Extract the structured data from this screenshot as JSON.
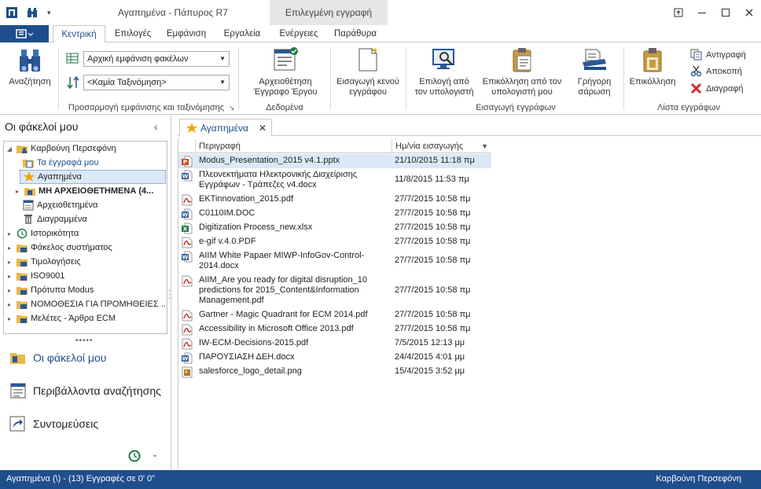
{
  "window": {
    "title": "Αγαπημένα - Πάπυρος R7",
    "context_tab": "Επιλεγμένη εγγραφή"
  },
  "ribbon": {
    "tabs": [
      "Κεντρική",
      "Επιλογές",
      "Εμφάνιση",
      "Εργαλεία",
      "Ενέργειες",
      "Παράθυρα"
    ],
    "active_tab": "Κεντρική",
    "search_label": "Αναζήτηση",
    "view_combo": "Αρχική εμφάνιση φακέλων",
    "sort_combo": "<Καμία Ταξινόμηση>",
    "group_view_label": "Προσαρμογή εμφάνισης και ταξινόμησης",
    "archive_btn": "Αρχειοθέτηση\nΈγγραφο Έργου",
    "group_data_label": "Δεδομένα",
    "insert_blank_btn": "Εισαγωγή κενού\nεγγράφου",
    "select_from_pc_btn": "Επιλογή από\nτον υπολογιστή",
    "paste_from_pc_btn": "Επικόλληση από τον\nυπολογιστή μου",
    "quick_scan_btn": "Γρήγορη\nσάρωση",
    "group_insert_label": "Εισαγωγή εγγράφων",
    "paste_btn": "Επικόλληση",
    "copy_btn": "Αντιγραφή",
    "cut_btn": "Αποκοπή",
    "delete_btn": "Διαγραφή",
    "group_list_label": "Λίστα εγγράφων"
  },
  "leftpane": {
    "header": "Οι φάκελοί μου",
    "tree": [
      {
        "label": "Καρβούνη Περσεφόνη",
        "level": 0,
        "expander": "▾",
        "icon": "user-folder-icon"
      },
      {
        "label": "Τα έγγραφά μου",
        "level": 1,
        "expander": "",
        "icon": "my-documents-icon",
        "link": true
      },
      {
        "label": "Αγαπημένα",
        "level": 1,
        "expander": "",
        "icon": "star-icon",
        "selected": true
      },
      {
        "label": "ΜΗ ΑΡΧΕΙΟΘΕΤΗΜΕΝΑ (4...",
        "level": 1,
        "expander": "▸",
        "icon": "unfiled-icon",
        "bold": true
      },
      {
        "label": "Αρχειοθετημένα",
        "level": 1,
        "expander": "",
        "icon": "archived-icon"
      },
      {
        "label": "Διαγραμμένα",
        "level": 1,
        "expander": "",
        "icon": "trash-icon"
      },
      {
        "label": "Ιστορικότητα",
        "level": 0,
        "expander": "▸",
        "icon": "history-icon"
      },
      {
        "label": "Φάκελος συστήματος",
        "level": 0,
        "expander": "▸",
        "icon": "folder-icon"
      },
      {
        "label": "Τιμολογήσεις",
        "level": 0,
        "expander": "▸",
        "icon": "folder-icon"
      },
      {
        "label": "ISO9001",
        "level": 0,
        "expander": "▸",
        "icon": "folder-icon"
      },
      {
        "label": "Πρότυπα Modus",
        "level": 0,
        "expander": "▸",
        "icon": "folder-icon"
      },
      {
        "label": "ΝΟΜΟΘΕΣΙΑ ΓΙΑ ΠΡΟΜΗΘΕΙΕΣ ...",
        "level": 0,
        "expander": "▸",
        "icon": "folder-icon"
      },
      {
        "label": "Μελέτες - Άρθρα ECM",
        "level": 0,
        "expander": "▸",
        "icon": "folder-icon"
      }
    ],
    "nav": [
      {
        "label": "Οι φάκελοί μου",
        "icon": "folders-nav-icon",
        "active": true
      },
      {
        "label": "Περιβάλλοντα αναζήτησης",
        "icon": "search-env-icon",
        "active": false
      },
      {
        "label": "Συντομεύσεις",
        "icon": "shortcut-icon",
        "active": false
      }
    ]
  },
  "doctab": {
    "label": "Αγαπημένα"
  },
  "grid": {
    "columns": [
      "Περιγραφή",
      "Ημ/νία εισαγωγής"
    ],
    "rows": [
      {
        "type": "pptx",
        "name": "Modus_Presentation_2015 v4.1.pptx",
        "date": "21/10/2015 11:18 πμ",
        "selected": true
      },
      {
        "type": "docx",
        "name": "Πλεονεκτήματα Ηλεκτρονικής Διαχείρισης Εγγράφων - Τράπεζες v4.docx",
        "date": "11/8/2015 11:53 πμ"
      },
      {
        "type": "pdf",
        "name": "EKTinnovation_2015.pdf",
        "date": "27/7/2015 10:58 πμ"
      },
      {
        "type": "doc",
        "name": "C0110IM.DOC",
        "date": "27/7/2015 10:58 πμ"
      },
      {
        "type": "xlsx",
        "name": "Digitization Process_new.xlsx",
        "date": "27/7/2015 10:58 πμ"
      },
      {
        "type": "pdf",
        "name": "e-gif v.4.0.PDF",
        "date": "27/7/2015 10:58 πμ"
      },
      {
        "type": "docx",
        "name": "AIIM White Papaer MIWP-InfoGov-Control-2014.docx",
        "date": "27/7/2015 10:58 πμ"
      },
      {
        "type": "pdf",
        "name": "AIIM_Are you ready for digital disruption_10 predictions for 2015_Content&Information Management.pdf",
        "date": "27/7/2015 10:58 πμ"
      },
      {
        "type": "pdf",
        "name": "Gartner - Magic Quadrant for ECM 2014.pdf",
        "date": "27/7/2015 10:58 πμ"
      },
      {
        "type": "pdf",
        "name": "Accessibility in Microsoft Office 2013.pdf",
        "date": "27/7/2015 10:58 πμ"
      },
      {
        "type": "pdf",
        "name": "IW-ECM-Decisions-2015.pdf",
        "date": "7/5/2015 12:13 μμ"
      },
      {
        "type": "docx",
        "name": "ΠΑΡΟΥΣΙΑΣΗ ΔΕΗ.docx",
        "date": "24/4/2015 4:01 μμ"
      },
      {
        "type": "png",
        "name": "salesforce_logo_detail.png",
        "date": "15/4/2015 3:52 μμ"
      }
    ]
  },
  "status": {
    "left": "Αγαπημένα (\\) - (13) Εγγραφές σε 0' 0\"",
    "right": "Καρβούνη Περσεφόνη"
  },
  "colors": {
    "accent": "#1e4e8c",
    "selection": "#dbe8f7",
    "pdf": "#c8281e",
    "word": "#2b5797",
    "excel": "#1f7a44",
    "ppt": "#d24726"
  }
}
